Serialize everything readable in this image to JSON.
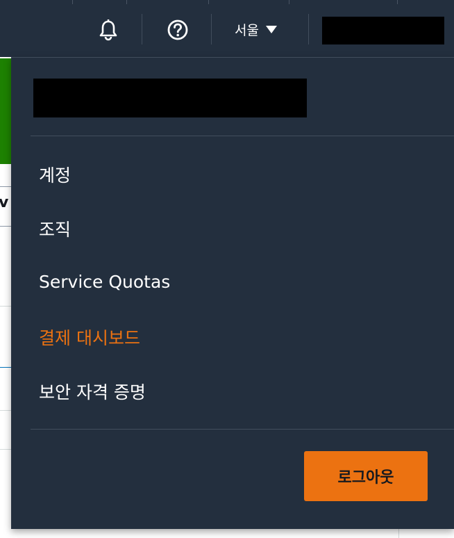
{
  "topbar": {
    "region_label": "서울"
  },
  "icons": {
    "notifications": "bell-icon",
    "help": "question-circle-icon",
    "region_caret": "caret-down-icon"
  },
  "background": {
    "fragment_text": "v"
  },
  "menu": {
    "items": [
      {
        "label": "계정"
      },
      {
        "label": "조직"
      },
      {
        "label": "Service Quotas"
      },
      {
        "label": "결제 대시보드"
      },
      {
        "label": "보안 자격 증명"
      }
    ],
    "logout_label": "로그아웃"
  },
  "colors": {
    "nav_bg": "#232f3e",
    "accent_orange": "#ec7211",
    "success_green": "#1d8102"
  }
}
